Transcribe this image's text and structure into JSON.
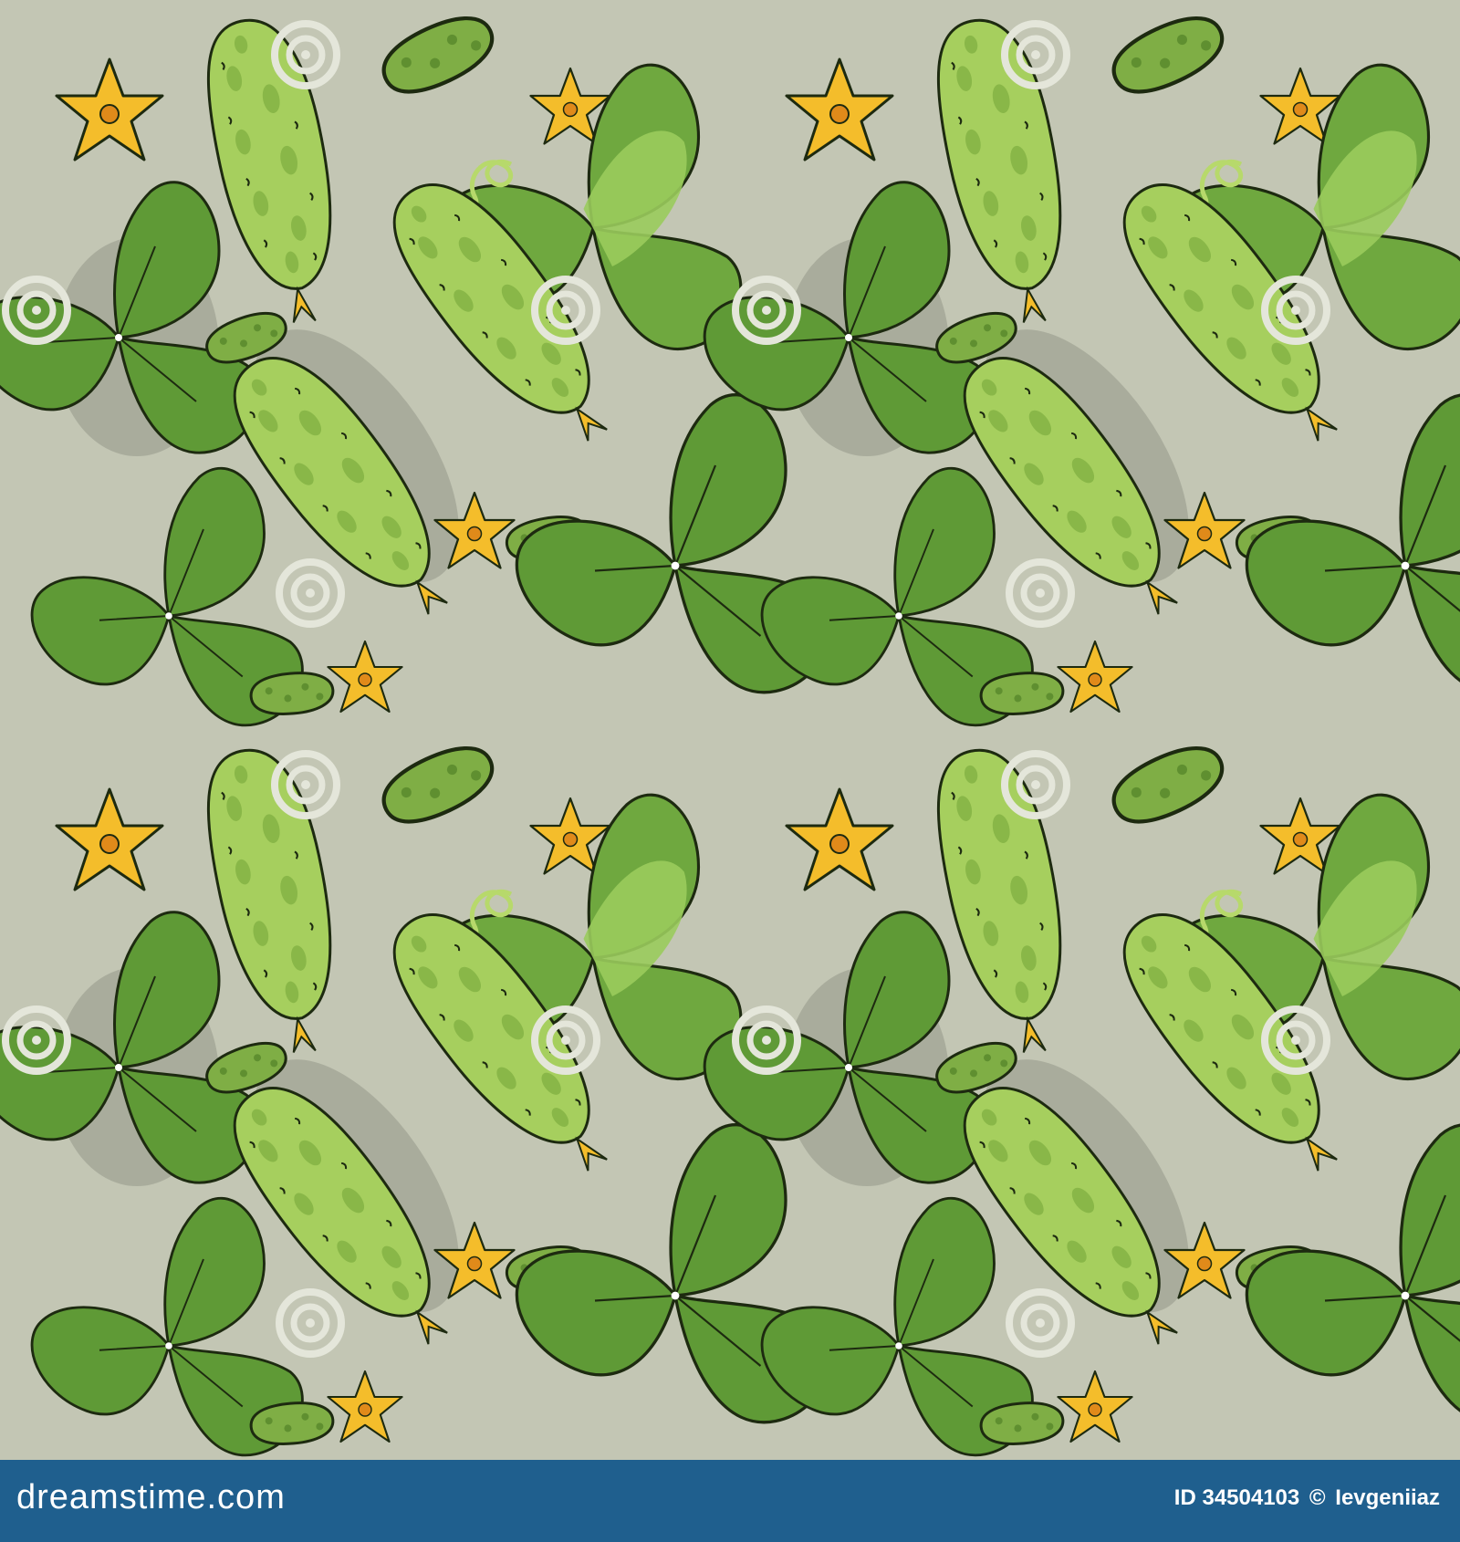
{
  "pattern": {
    "background_color": "#c3c6b4",
    "shadow_color": "#a9ac9c",
    "leaf_dark_color": "#5f9a36",
    "leaf_light_color": "#9acb5c",
    "cucumber_color": "#a6cf5e",
    "cucumber_spot_color": "#89b748",
    "flower_color": "#f4bd2b",
    "outline_color": "#1d2a10",
    "watermark_color": "#e4e6da"
  },
  "watermark": {
    "text": "dreamstime"
  },
  "footer": {
    "background_color": "#1f5f8e",
    "site": "dreamstime.com",
    "image_id": "ID 34504103",
    "copyright_symbol": "©",
    "author": "Ievgeniiaz"
  }
}
